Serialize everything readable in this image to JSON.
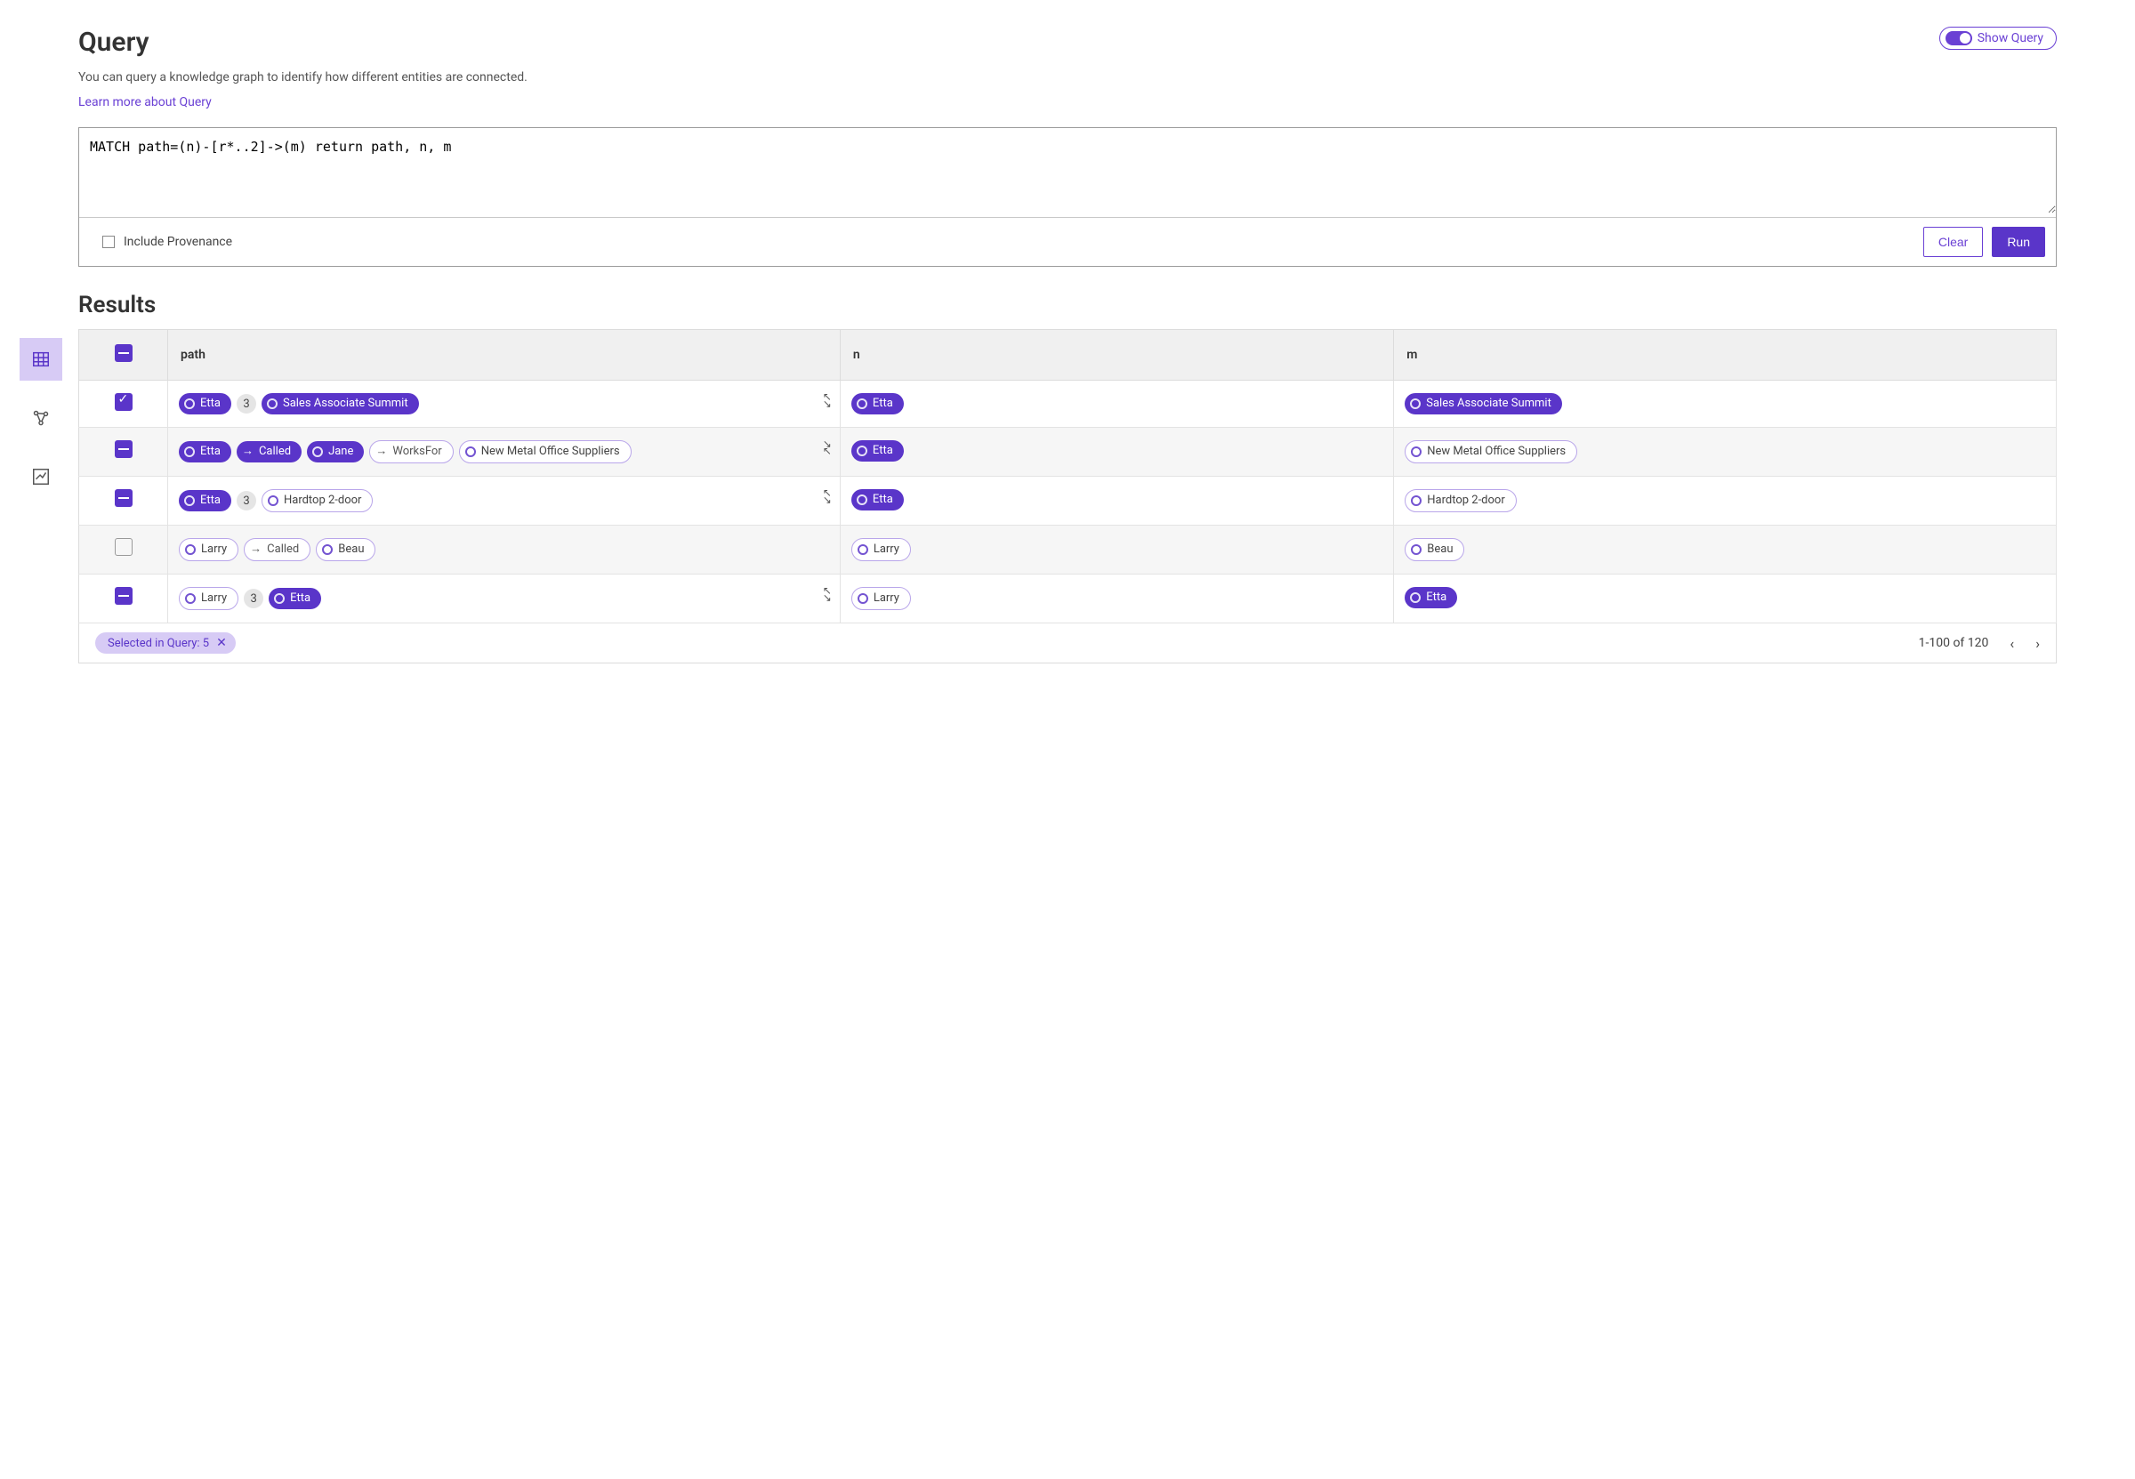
{
  "header": {
    "title": "Query",
    "description": "You can query a knowledge graph to identify how different entities are connected.",
    "learn_more": "Learn more about Query",
    "show_query_label": "Show Query"
  },
  "query": {
    "text": "MATCH path=(n)-[r*..2]->(m) return path, n, m",
    "include_provenance_label": "Include Provenance",
    "clear_label": "Clear",
    "run_label": "Run"
  },
  "results": {
    "heading": "Results",
    "columns": {
      "path": "path",
      "n": "n",
      "m": "m"
    },
    "rows": [
      {
        "select_state": "checked",
        "expand": "expand",
        "path": [
          {
            "kind": "node",
            "style": "filled",
            "label": "Etta"
          },
          {
            "kind": "count",
            "label": "3"
          },
          {
            "kind": "node",
            "style": "filled",
            "label": "Sales Associate Summit"
          }
        ],
        "n": {
          "style": "filled",
          "label": "Etta"
        },
        "m": {
          "style": "filled",
          "label": "Sales Associate Summit"
        }
      },
      {
        "select_state": "indet",
        "expand": "collapse",
        "path": [
          {
            "kind": "node",
            "style": "filled",
            "label": "Etta"
          },
          {
            "kind": "rel",
            "style": "filled",
            "label": "Called"
          },
          {
            "kind": "node",
            "style": "filled",
            "label": "Jane"
          },
          {
            "kind": "rel",
            "style": "outline",
            "label": "WorksFor"
          },
          {
            "kind": "node",
            "style": "outline",
            "label": "New Metal Office Suppliers"
          }
        ],
        "n": {
          "style": "filled",
          "label": "Etta"
        },
        "m": {
          "style": "outline",
          "label": "New Metal Office Suppliers"
        }
      },
      {
        "select_state": "indet",
        "expand": "expand",
        "path": [
          {
            "kind": "node",
            "style": "filled",
            "label": "Etta"
          },
          {
            "kind": "count",
            "label": "3"
          },
          {
            "kind": "node",
            "style": "outline",
            "label": "Hardtop 2-door"
          }
        ],
        "n": {
          "style": "filled",
          "label": "Etta"
        },
        "m": {
          "style": "outline",
          "label": "Hardtop 2-door"
        }
      },
      {
        "select_state": "empty",
        "expand": "none",
        "path": [
          {
            "kind": "node",
            "style": "outline",
            "label": "Larry"
          },
          {
            "kind": "rel",
            "style": "outline",
            "label": "Called"
          },
          {
            "kind": "node",
            "style": "outline",
            "label": "Beau"
          }
        ],
        "n": {
          "style": "outline",
          "label": "Larry"
        },
        "m": {
          "style": "outline",
          "label": "Beau"
        }
      },
      {
        "select_state": "indet",
        "expand": "expand",
        "path": [
          {
            "kind": "node",
            "style": "outline",
            "label": "Larry"
          },
          {
            "kind": "count",
            "label": "3"
          },
          {
            "kind": "node",
            "style": "filled",
            "label": "Etta"
          }
        ],
        "n": {
          "style": "outline",
          "label": "Larry"
        },
        "m": {
          "style": "filled",
          "label": "Etta"
        }
      }
    ],
    "selected_label": "Selected in Query: 5",
    "range_label": "1-100 of 120"
  }
}
